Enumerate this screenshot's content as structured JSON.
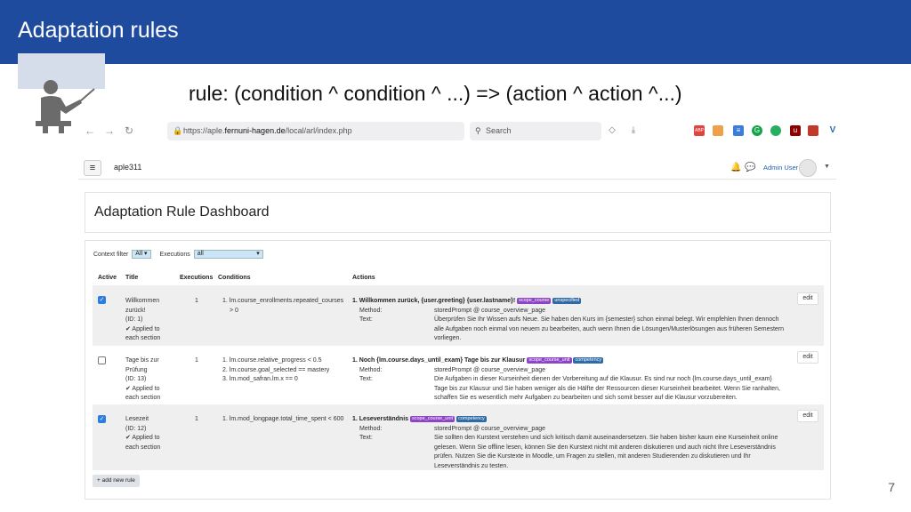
{
  "slide": {
    "title": "Adaptation rules",
    "formula": "rule: (condition ^ condition ^ ...) => (action ^ action ^...)",
    "page_number": "7"
  },
  "browser": {
    "url_prefix": "https://aple.",
    "url_host": "fernuni-hagen.de",
    "url_suffix": "/local/arl/index.php",
    "search_placeholder": "Search",
    "nav_icons": [
      "back-arrow-icon",
      "forward-arrow-icon",
      "reload-icon"
    ],
    "toolbar_icons": [
      "pocket-icon",
      "download-icon",
      "abp-extension-icon",
      "extension-icon",
      "stack-extension-icon",
      "grammarly-icon",
      "green-extension-icon",
      "ublock-icon",
      "red-extension-icon",
      "v-extension-icon",
      "puzzle-icon",
      "menu-icon"
    ]
  },
  "moodle": {
    "site_name": "aple311",
    "user_name": "Admin User",
    "page_title": "Adaptation Rule Dashboard",
    "filters": {
      "context_label": "Context filter",
      "context_value": "All",
      "executions_label": "Executions",
      "executions_value": "all"
    },
    "columns": {
      "active": "Active",
      "title": "Title",
      "executions": "Executions",
      "conditions": "Conditions",
      "actions": "Actions"
    },
    "method_label": "Method:",
    "text_label": "Text:",
    "edit_label": "edit",
    "add_rule_label": "+ add new rule",
    "rules": [
      {
        "active": true,
        "title_lines": [
          "Willkommen",
          "zurück!",
          "(ID: 1)",
          "✔ Applied to",
          "each section"
        ],
        "executions": "1",
        "conditions": [
          "1. lm.course_enrollments.repeated_courses",
          "    > 0"
        ],
        "action_title": "1. Willkommen zurück, {user.greeting} {user.lastname}!",
        "badges": [
          {
            "label": "scope_course",
            "color": "#8e44c6"
          },
          {
            "label": "unspecified",
            "color": "#2d6aa6"
          }
        ],
        "method": "storedPrompt @ course_overview_page",
        "text_lines": [
          "Überprüfen Sie Ihr Wissen aufs Neue. Sie haben den Kurs im {semester} schon einmal belegt. Wir empfehlen Ihnen dennoch",
          "alle Aufgaben noch einmal von neuem zu bearbeiten, auch wenn Ihnen die Lösungen/Musterlösungen aus früheren Semestern",
          "vorliegen."
        ]
      },
      {
        "active": false,
        "title_lines": [
          "Tage bis zur",
          "Prüfung",
          "(ID: 13)",
          "✔ Applied to",
          "each section"
        ],
        "executions": "1",
        "conditions": [
          "1. lm.course.relative_progress < 0.5",
          "2. lm.course.goal_selected == mastery",
          "3. lm.mod_safran.lm.x == 0"
        ],
        "action_title": "1. Noch {lm.course.days_until_exam} Tage bis zur Klausur",
        "badges": [
          {
            "label": "scope_course_unit",
            "color": "#8e44c6"
          },
          {
            "label": "competency",
            "color": "#2d6aa6"
          }
        ],
        "method": "storedPrompt @ course_overview_page",
        "text_lines": [
          "Die Aufgaben in dieser Kurseinheit dienen der Vorbereitung auf die Klausur. Es sind nur noch {lm.course.days_until_exam}",
          "Tage bis zur Klausur und Sie haben weniger als die Hälfte der Ressourcen dieser Kurseinheit bearbeitet. Wenn Sie ranhalten,",
          "schaffen Sie es wesentlich mehr Aufgaben zu bearbeiten und sich somit besser auf die Klausur vorzubereiten."
        ]
      },
      {
        "active": true,
        "title_lines": [
          "Lesezeit",
          "(ID: 12)",
          "✔ Applied to",
          "each section"
        ],
        "executions": "1",
        "conditions": [
          "1. lm.mod_longpage.total_time_spent < 600"
        ],
        "action_title": "1. Leseverständnis",
        "badges": [
          {
            "label": "scope_course_unit",
            "color": "#8e44c6"
          },
          {
            "label": "competency",
            "color": "#2d6aa6"
          }
        ],
        "method": "storedPrompt @ course_overview_page",
        "text_lines": [
          "Sie sollten den Kurstext verstehen und sich kritisch damit auseinandersetzen. Sie haben bisher kaum eine Kurseinheit online",
          "gelesen. Wenn Sie offline lesen, können Sie den Kurstext nicht mit anderen diskutieren und auch nicht Ihre Leseverständnis",
          "prüfen. Nutzen Sie die Kurstexte in Moodle, um Fragen zu stellen, mit anderen Studierenden zu diskutieren und Ihr",
          "Leseverständnis zu testen."
        ]
      }
    ]
  }
}
